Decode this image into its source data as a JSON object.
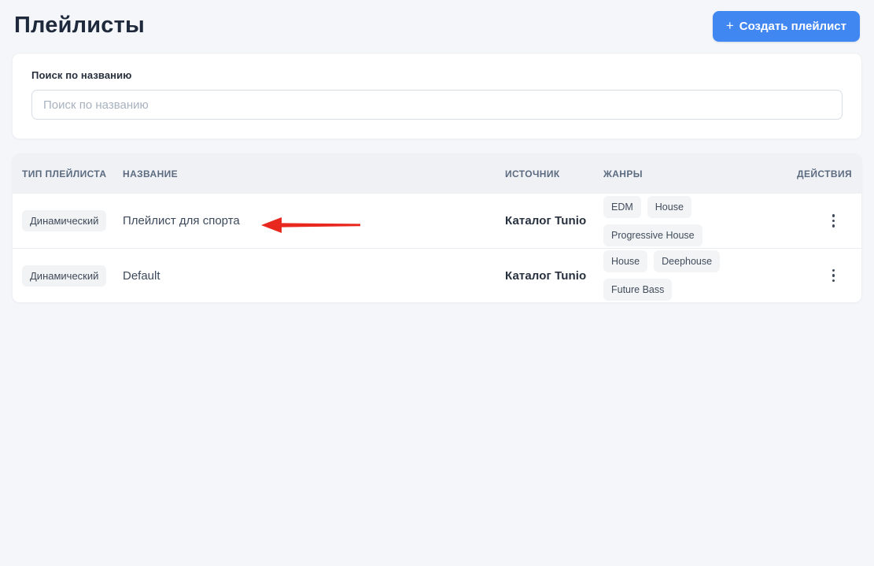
{
  "page": {
    "title": "Плейлисты"
  },
  "header": {
    "create_button": {
      "plus": "+",
      "label": "Создать плейлист",
      "color": "#4187f2"
    }
  },
  "search": {
    "label": "Поиск по названию",
    "placeholder": "Поиск по названию"
  },
  "table": {
    "columns": {
      "type": "Тип плейлиста",
      "name": "Название",
      "source": "Источник",
      "genres": "Жанры",
      "actions": "Действия"
    },
    "rows": [
      {
        "type": "Динамический",
        "name": "Плейлист для спорта",
        "source": "Каталог Tunio",
        "genres": {
          "0": "EDM",
          "1": "House",
          "2": "Progressive House"
        }
      },
      {
        "type": "Динамический",
        "name": "Default",
        "source": "Каталог Tunio",
        "genres": {
          "0": "House",
          "1": "Deephouse",
          "2": "Future Bass"
        }
      }
    ]
  },
  "annotation": {
    "arrow_color": "#e8281e"
  }
}
